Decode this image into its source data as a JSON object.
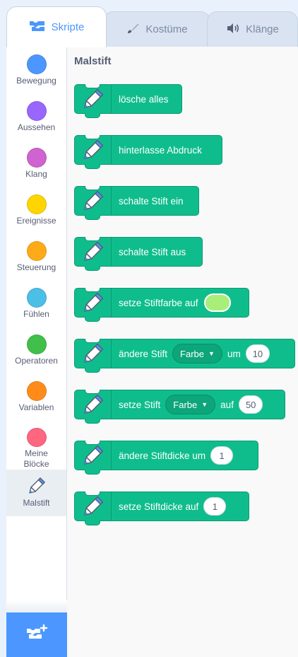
{
  "tabs": [
    {
      "label": "Skripte",
      "icon": "code-icon"
    },
    {
      "label": "Kostüme",
      "icon": "brush-icon"
    },
    {
      "label": "Klänge",
      "icon": "speaker-icon"
    }
  ],
  "categories": [
    {
      "label": "Bewegung",
      "color": "#4c97ff"
    },
    {
      "label": "Aussehen",
      "color": "#9966ff"
    },
    {
      "label": "Klang",
      "color": "#cf63cf"
    },
    {
      "label": "Ereignisse",
      "color": "#ffd500"
    },
    {
      "label": "Steuerung",
      "color": "#ffab19"
    },
    {
      "label": "Fühlen",
      "color": "#4cbfe6"
    },
    {
      "label": "Operatoren",
      "color": "#40bf4a"
    },
    {
      "label": "Variablen",
      "color": "#ff8c1a"
    },
    {
      "label_line1": "Meine",
      "label_line2": "Blöcke",
      "color": "#ff6680"
    },
    {
      "label": "Malstift",
      "icon": "pen-icon",
      "selected": true
    }
  ],
  "extension_button": {
    "icon": "add-extension-icon"
  },
  "palette": {
    "title": "Malstift",
    "block_color": "#0fbd8c",
    "blocks": [
      {
        "text": "lösche alles"
      },
      {
        "text": "hinterlasse Abdruck"
      },
      {
        "text": "schalte Stift ein"
      },
      {
        "text": "schalte Stift aus"
      },
      {
        "text": "setze Stiftfarbe auf",
        "color_value": "#a9ee79"
      },
      {
        "text": "ändere Stift",
        "dropdown": "Farbe",
        "text2": "um",
        "value": "10"
      },
      {
        "text": "setze Stift",
        "dropdown": "Farbe",
        "text2": "auf",
        "value": "50"
      },
      {
        "text": "ändere Stiftdicke um",
        "value": "1"
      },
      {
        "text": "setze Stiftdicke auf",
        "value": "1"
      }
    ]
  }
}
